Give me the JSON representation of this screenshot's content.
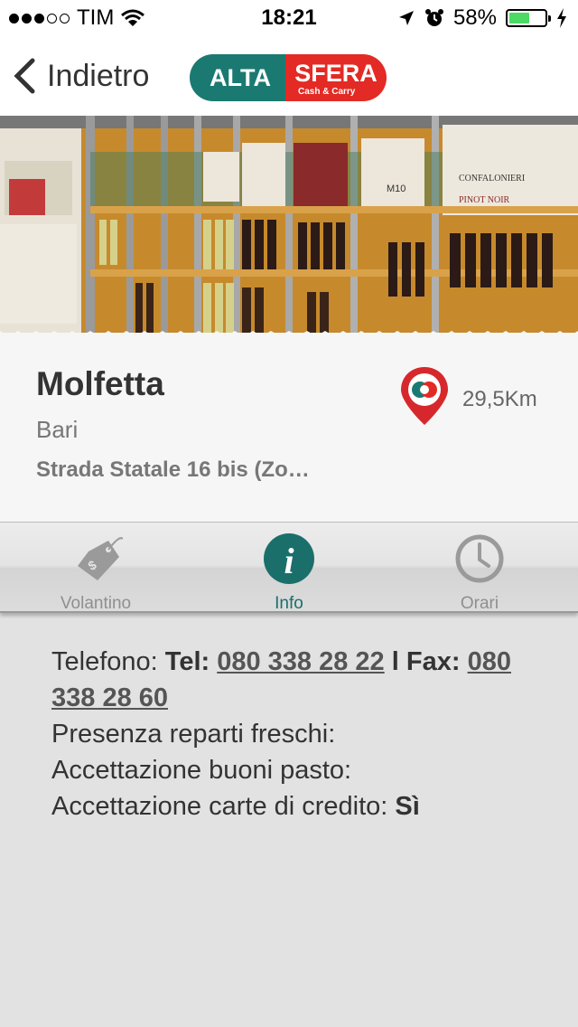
{
  "status_bar": {
    "carrier": "TIM",
    "time": "18:21",
    "battery_percent": "58%",
    "battery_level": 0.58,
    "signal_bars_filled": 3,
    "signal_bars_total": 5
  },
  "nav": {
    "back_label": "Indietro",
    "logo_left": "ALTA",
    "logo_right": "SFERA",
    "logo_sub": "Cash & Carry"
  },
  "hero": {
    "label_m10": "M10",
    "label_brand": "CONFALONIERI",
    "label_pinot": "PINOT NOIR"
  },
  "store": {
    "name": "Molfetta",
    "city": "Bari",
    "address": "Strada Statale 16 bis (Zo…",
    "distance": "29,5Km"
  },
  "tabs": [
    {
      "label": "Volantino",
      "icon": "price-tag-icon",
      "active": false
    },
    {
      "label": "Info",
      "icon": "info-icon",
      "active": true
    },
    {
      "label": "Orari",
      "icon": "clock-icon",
      "active": false
    }
  ],
  "info": {
    "phone_label": "Telefono:",
    "tel_label": "Tel:",
    "tel_number": "080 338 28 22",
    "separator": "l",
    "fax_label": "Fax:",
    "fax_number": "080 338 28 60",
    "fresh_label": "Presenza reparti freschi:",
    "meal_label": "Accettazione buoni pasto:",
    "card_label": "Accettazione carte di credito:",
    "card_value": "Sì"
  },
  "colors": {
    "brand_teal": "#1a7a72",
    "brand_red": "#e32a24",
    "active_tab": "#1a6f6b",
    "battery_green": "#4cd964"
  }
}
